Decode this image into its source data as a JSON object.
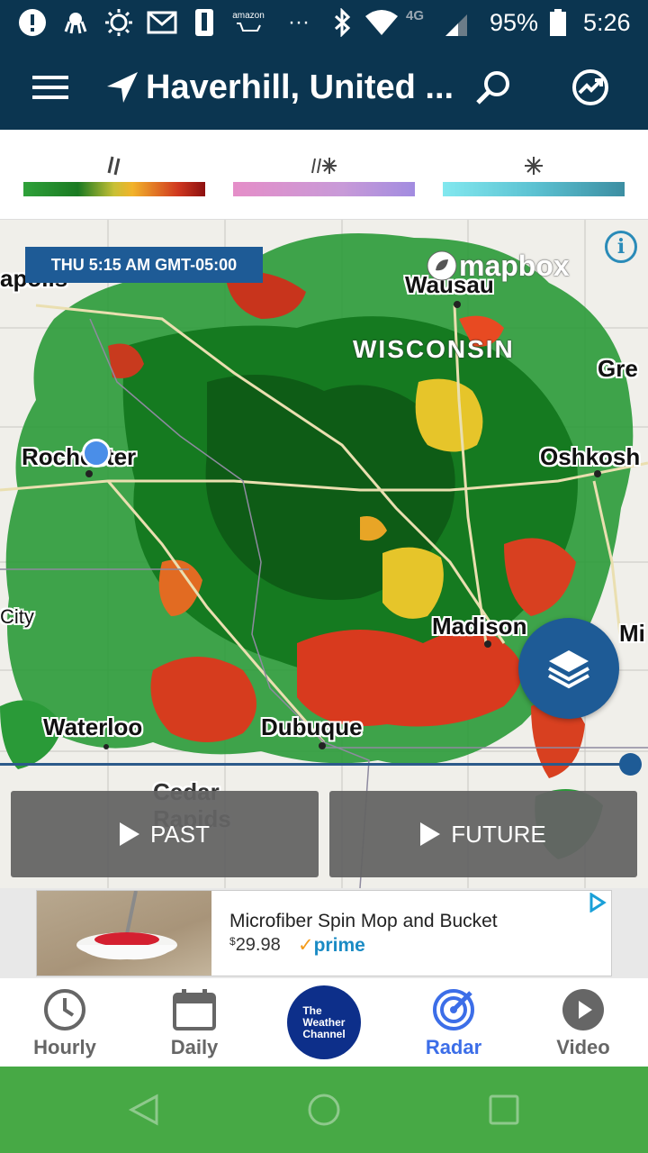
{
  "status_bar": {
    "battery": "95%",
    "time": "5:26",
    "network": "4G LTE",
    "icons": [
      "alert-icon",
      "octopus-icon",
      "sun-icon",
      "gmail-icon",
      "phone-icon",
      "amazon-icon",
      "more-icon",
      "bluetooth-icon",
      "wifi-icon",
      "signal-icon",
      "battery-icon"
    ],
    "amazon_text": "amazon"
  },
  "header": {
    "location": "Haverhill, United ...",
    "icons": [
      "menu-icon",
      "navigation-arrow-icon",
      "search-icon",
      "trending-icon"
    ]
  },
  "legend": {
    "items": [
      {
        "type": "rain",
        "icon": "rain-icon"
      },
      {
        "type": "mix",
        "icon": "mix-icon"
      },
      {
        "type": "snow",
        "icon": "snow-icon"
      }
    ]
  },
  "map": {
    "timestamp": "THU 5:15 AM GMT-05:00",
    "attribution": "mapbox",
    "state_label": "WISCONSIN",
    "cities": [
      {
        "name": "Wausau"
      },
      {
        "name": "Rochester"
      },
      {
        "name": "Oshkosh"
      },
      {
        "name": "Madison"
      },
      {
        "name": "Waterloo"
      },
      {
        "name": "Dubuque"
      },
      {
        "name": "Cedar Rapids"
      },
      {
        "name": "City"
      },
      {
        "name": "Gre"
      },
      {
        "name": "Mi"
      },
      {
        "name": "apolis"
      }
    ],
    "past_label": "PAST",
    "future_label": "FUTURE"
  },
  "ad": {
    "title": "Microfiber Spin Mop and Bucket",
    "currency": "$",
    "price": "29.98",
    "badge": "prime"
  },
  "bottom_nav": {
    "items": [
      {
        "label": "Hourly",
        "icon": "clock-icon",
        "active": false
      },
      {
        "label": "Daily",
        "icon": "calendar-icon",
        "active": false
      },
      {
        "label": "The Weather Channel",
        "icon": "twc-logo",
        "active": false
      },
      {
        "label": "Radar",
        "icon": "radar-icon",
        "active": true
      },
      {
        "label": "Video",
        "icon": "play-icon",
        "active": false
      }
    ],
    "twc_lines": [
      "The",
      "Weather",
      "Channel"
    ]
  },
  "colors": {
    "header_bg": "#0b3550",
    "accent": "#1e5b96",
    "active_nav": "#3c6ee8",
    "system_nav": "#47a945"
  }
}
